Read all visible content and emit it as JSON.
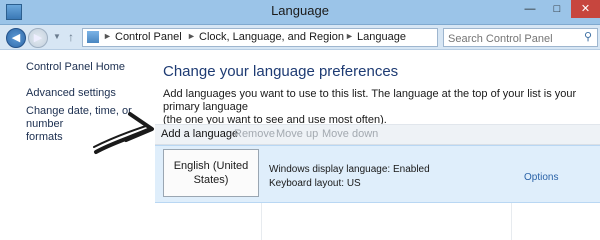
{
  "window": {
    "title": "Language"
  },
  "nav": {
    "breadcrumbs": [
      "Control Panel",
      "Clock, Language, and Region",
      "Language"
    ],
    "search_placeholder": "Search Control Panel"
  },
  "left_pane": {
    "home": "Control Panel Home",
    "advanced": "Advanced settings",
    "change_date_line1": "Change date, time, or number",
    "change_date_line2": "formats"
  },
  "main": {
    "heading": "Change your language preferences",
    "description_line1": "Add languages you want to use to this list. The language at the top of your list is your primary language",
    "description_line2": "(the one you want to see and use most often).",
    "toolbar": {
      "add": "Add a language",
      "remove": "Remove",
      "move_up": "Move up",
      "move_down": "Move down"
    },
    "languages": [
      {
        "name_line1": "English (United",
        "name_line2": "States)",
        "display_language": "Windows display language: Enabled",
        "keyboard_layout": "Keyboard layout: US",
        "options": "Options"
      }
    ]
  },
  "colors": {
    "titlebar": "#9bc4e8",
    "heading": "#1e3b73",
    "link": "#2a62a7",
    "selected_row": "#dfeefb"
  }
}
